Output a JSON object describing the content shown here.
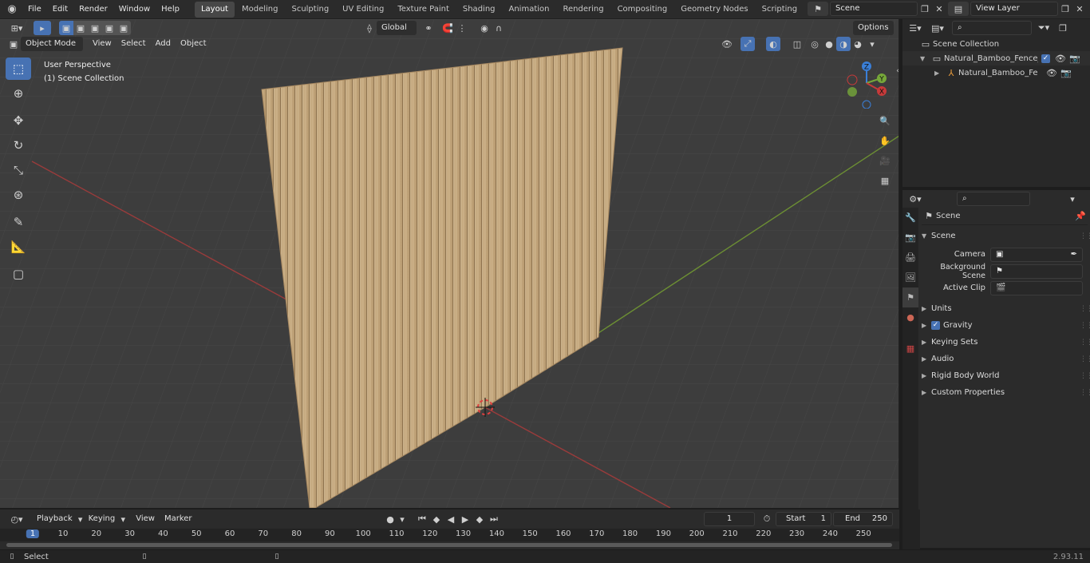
{
  "topbar": {
    "menu": [
      "File",
      "Edit",
      "Render",
      "Window",
      "Help"
    ],
    "workspaces": [
      "Layout",
      "Modeling",
      "Sculpting",
      "UV Editing",
      "Texture Paint",
      "Shading",
      "Animation",
      "Rendering",
      "Compositing",
      "Geometry Nodes",
      "Scripting"
    ],
    "active_workspace": "Layout",
    "scene_name": "Scene",
    "view_layer": "View Layer"
  },
  "viewport": {
    "mode": "Object Mode",
    "menus": [
      "View",
      "Select",
      "Add",
      "Object"
    ],
    "orientation": "Global",
    "options_label": "Options",
    "overlay_line1": "User Perspective",
    "overlay_line2": "(1) Scene Collection",
    "axes": {
      "x": "X",
      "y": "Y",
      "z": "Z"
    },
    "colors": {
      "x_axis": "#c73a3a",
      "y_axis": "#76a839",
      "z_axis": "#3a7fd8",
      "active_tool": "#4772b3"
    }
  },
  "outliner": {
    "rows": [
      {
        "label": "Scene Collection"
      },
      {
        "label": "Natural_Bamboo_Fence_Gree"
      },
      {
        "label": "Natural_Bamboo_Fence_"
      }
    ]
  },
  "properties": {
    "context_title": "Scene",
    "section_title": "Scene",
    "fields": [
      {
        "label": "Camera"
      },
      {
        "label": "Background Scene"
      },
      {
        "label": "Active Clip"
      }
    ],
    "panels": [
      "Units",
      "Gravity",
      "Keying Sets",
      "Audio",
      "Rigid Body World",
      "Custom Properties"
    ]
  },
  "timeline": {
    "menus": [
      "Playback",
      "Keying",
      "View",
      "Marker"
    ],
    "current_frame": "1",
    "start_label": "Start",
    "start_value": "1",
    "end_label": "End",
    "end_value": "250",
    "ruler": [
      "1",
      "10",
      "20",
      "30",
      "40",
      "50",
      "60",
      "70",
      "80",
      "90",
      "100",
      "110",
      "120",
      "130",
      "140",
      "150",
      "160",
      "170",
      "180",
      "190",
      "200",
      "210",
      "220",
      "230",
      "240",
      "250"
    ]
  },
  "statusbar": {
    "left": "Select",
    "version": "2.93.11"
  }
}
